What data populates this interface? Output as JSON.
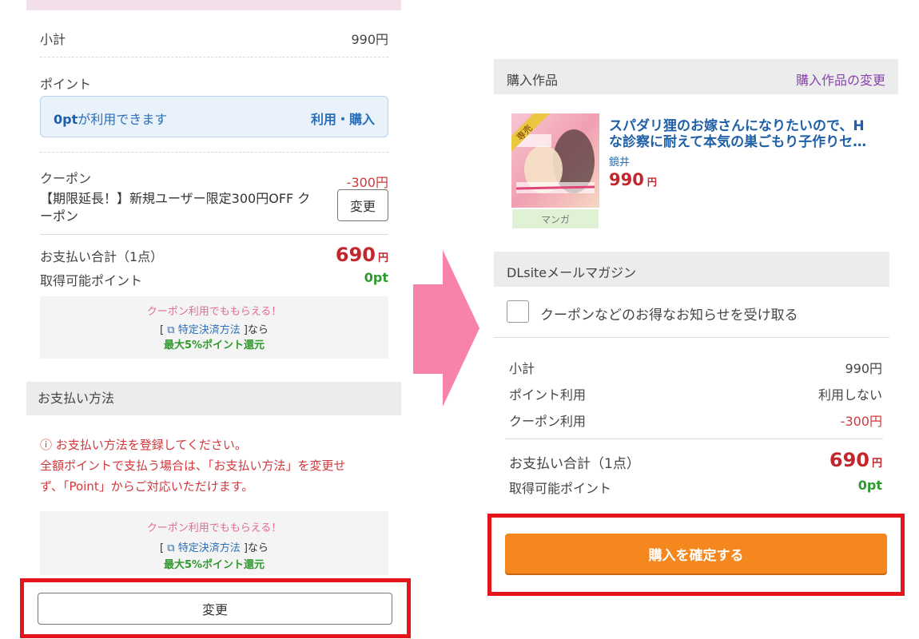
{
  "left": {
    "subtotal_label": "小計",
    "subtotal_value": "990円",
    "points_label": "ポイント",
    "points_available_bold": "0pt",
    "points_available_text": "が利用できます",
    "points_action": "利用・購入",
    "coupon_label": "クーポン",
    "coupon_discount": "-300円",
    "coupon_name": "【期限延長！】新規ユーザー限定300円OFF クーポン",
    "coupon_change_button": "変更",
    "total_label": "お支払い合計（1点）",
    "total_value": "690",
    "total_unit": "円",
    "earnable_label": "取得可能ポイント",
    "earnable_value": "0pt",
    "promo": {
      "line1": "クーポン利用でももらえる！",
      "bracket_open": "[",
      "link_text": "特定決済方法",
      "bracket_close": "]なら",
      "line3": "最大5%ポイント還元"
    },
    "payment_header": "お支払い方法",
    "payment_warning_line1": "お支払い方法を登録してください。",
    "payment_warning_line2": "全額ポイントで支払う場合は、「お支払い方法」を変更せ",
    "payment_warning_line3": "ず、「Point」からご対応いただけます。",
    "payment_change_button": "変更"
  },
  "right": {
    "purchase_header": "購入作品",
    "purchase_change_link": "購入作品の変更",
    "badge": "専売",
    "product_title": "スパダリ狸のお嫁さんになりたいので、Hな診察に耐えて本気の巣ごもり子作りセ…",
    "product_author": "鏡井",
    "product_price": "990",
    "product_price_unit": "円",
    "product_tag": "マンガ",
    "mail_header": "DLsiteメールマガジン",
    "mail_checkbox_label": "クーポンなどのお得なお知らせを受け取る",
    "subtotal_label": "小計",
    "subtotal_value": "990円",
    "point_use_label": "ポイント利用",
    "point_use_value": "利用しない",
    "coupon_use_label": "クーポン利用",
    "coupon_use_value": "-300円",
    "total_label": "お支払い合計（1点）",
    "total_value": "690",
    "total_unit": "円",
    "earnable_label": "取得可能ポイント",
    "earnable_value": "0pt",
    "confirm_button": "購入を確定する"
  },
  "colors": {
    "accent_red": "#c1272d",
    "link_blue": "#2a6fb8",
    "point_green": "#2f9a2f",
    "confirm_orange": "#f5871f",
    "highlight_frame": "#e4151b",
    "arrow_pink": "#f883a8"
  }
}
